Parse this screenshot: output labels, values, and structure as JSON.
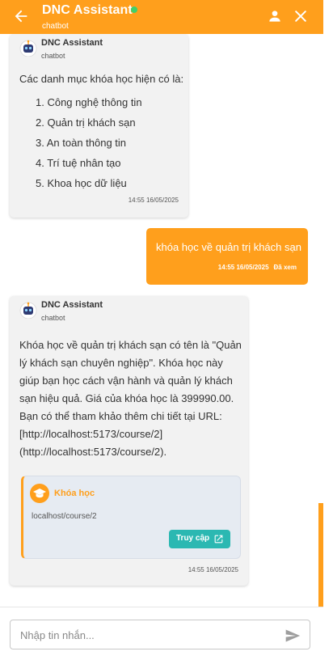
{
  "header": {
    "title": "DNC Assistant",
    "subtitle": "chatbot",
    "colors": {
      "brand": "#ff9f1c",
      "online": "#3fd06b"
    }
  },
  "messages": {
    "m1": {
      "sender": "DNC Assistant",
      "role": "chatbot",
      "intro": "Các danh mục khóa học hiện có là:",
      "items": [
        "1. Công nghệ thông tin",
        "2. Quản trị khách sạn",
        "3. An toàn thông tin",
        "4. Trí tuệ nhân tạo",
        "5. Khoa học dữ liệu"
      ],
      "time": "14:55 16/05/2025"
    },
    "m2": {
      "text": "khóa học về quản trị khách sạn",
      "time": "14:55 16/05/2025",
      "status": "Đã xem"
    },
    "m3": {
      "sender": "DNC Assistant",
      "role": "chatbot",
      "lines": [
        "Khóa học về quản trị khách sạn có tên là \"Quản",
        "lý khách sạn chuyên nghiệp\". Khóa học này",
        "giúp bạn học cách vận hành và quản lý khách",
        "sạn hiệu quả. Giá của khóa học là 399990.00.",
        "Bạn có thể tham khảo thêm chi tiết tại URL:",
        "[http://localhost:5173/course/2]",
        "(http://localhost:5173/course/2)."
      ],
      "card": {
        "title": "Khóa học",
        "url": "localhost/course/2",
        "button": "Truy cập",
        "colors": {
          "accent": "#ff9f1c",
          "button": "#2bb8b2"
        }
      },
      "time": "14:55 16/05/2025"
    }
  },
  "composer": {
    "placeholder": "Nhập tin nhắn...",
    "value": ""
  },
  "icons": [
    "back-arrow-icon",
    "online-dot",
    "person-icon",
    "close-icon",
    "robot-avatar-icon",
    "graduation-cap-icon",
    "external-link-icon",
    "send-icon"
  ]
}
